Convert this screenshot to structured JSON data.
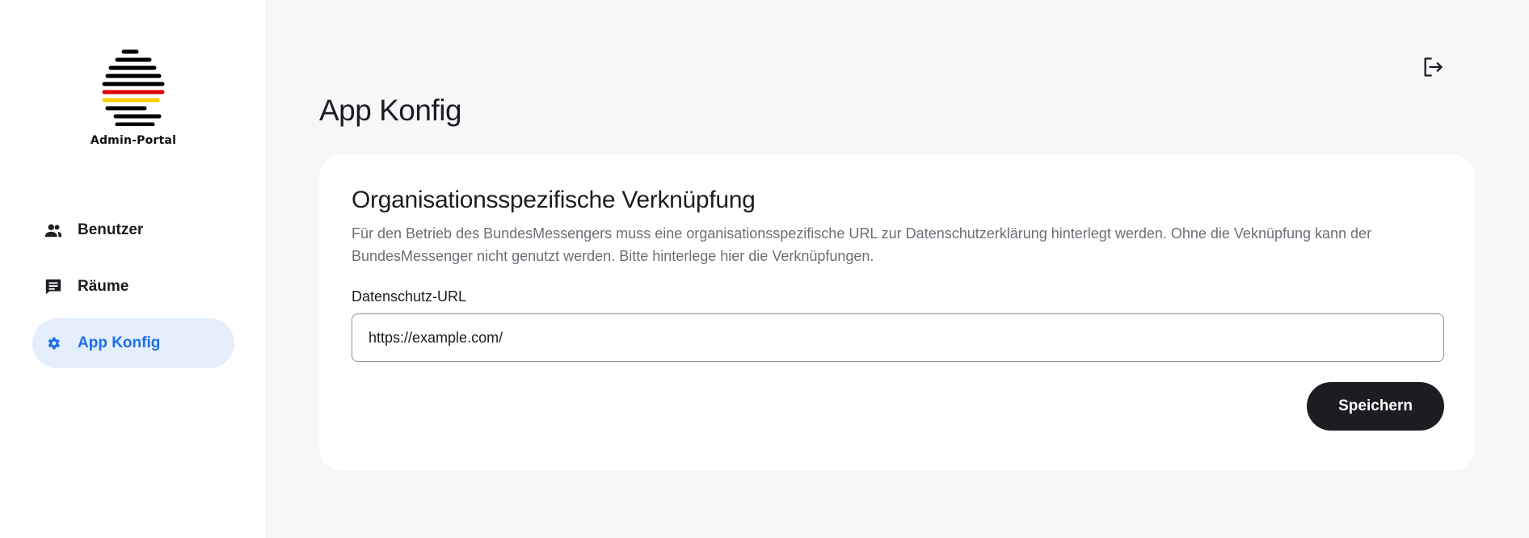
{
  "app": {
    "logo_label": "Admin-Portal",
    "logo_icon": "german-flag-stripes-logo"
  },
  "sidebar": {
    "items": [
      {
        "label": "Benutzer",
        "icon": "people-icon",
        "active": false
      },
      {
        "label": "Räume",
        "icon": "chat-message-icon",
        "active": false
      },
      {
        "label": "App Konfig",
        "icon": "gear-icon",
        "active": true
      }
    ]
  },
  "header": {
    "logout_icon": "logout-icon"
  },
  "main": {
    "page_title": "App Konfig",
    "card": {
      "title": "Organisationsspezifische Verknüpfung",
      "description": "Für den Betrieb des BundesMessengers muss eine organisationsspezifische URL zur Datenschutzerklärung hinterlegt werden. Ohne die Veknüpfung kann der BundesMessenger nicht genutzt werden. Bitte hinterlege hier die Verknüpfungen.",
      "field_label": "Datenschutz-URL",
      "field_value": "https://example.com/",
      "save_label": "Speichern"
    }
  },
  "colors": {
    "accent": "#1f6feb",
    "active_bg": "#e4eefc",
    "button_bg": "#1b1d21",
    "page_bg": "#f6f7f9"
  }
}
